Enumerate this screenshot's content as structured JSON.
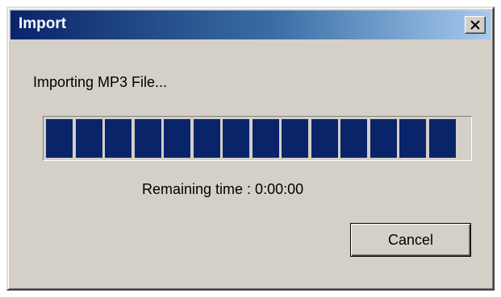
{
  "dialog": {
    "title": "Import",
    "status": "Importing MP3 File...",
    "remaining_time": "Remaining time : 0:00:00",
    "cancel_label": "Cancel"
  },
  "progress": {
    "filled_blocks": 14,
    "total_blocks": 15,
    "fraction": 0.93
  },
  "icons": {
    "close": "close-icon"
  },
  "colors": {
    "title_start": "#0a246a",
    "title_end": "#a6caf0",
    "dialog_bg": "#d4d0c8",
    "progress_fill": "#0a246a"
  }
}
